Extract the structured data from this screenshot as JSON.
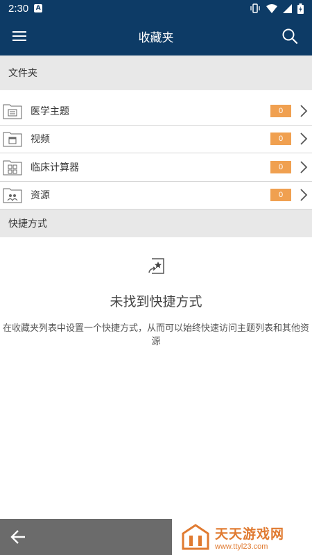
{
  "status_bar": {
    "time": "2:30",
    "badge": "A"
  },
  "app_bar": {
    "title": "收藏夹"
  },
  "folders_section": {
    "title": "文件夹"
  },
  "folders": [
    {
      "label": "医学主题",
      "count": "0",
      "icon": "topic-folder-icon"
    },
    {
      "label": "视频",
      "count": "0",
      "icon": "video-folder-icon"
    },
    {
      "label": "临床计算器",
      "count": "0",
      "icon": "calculator-folder-icon"
    },
    {
      "label": "资源",
      "count": "0",
      "icon": "resource-folder-icon"
    }
  ],
  "shortcuts_section": {
    "title": "快捷方式"
  },
  "empty_state": {
    "title": "未找到快捷方式",
    "description": "在收藏夹列表中设置一个快捷方式，从而可以始终快速访问主题列表和其他资源"
  },
  "watermark": {
    "name": "天天游戏网",
    "url": "www.ttyl23.com"
  },
  "colors": {
    "primary": "#0d3b66",
    "badge": "#f0a050",
    "section_bg": "#e8e8e8"
  }
}
